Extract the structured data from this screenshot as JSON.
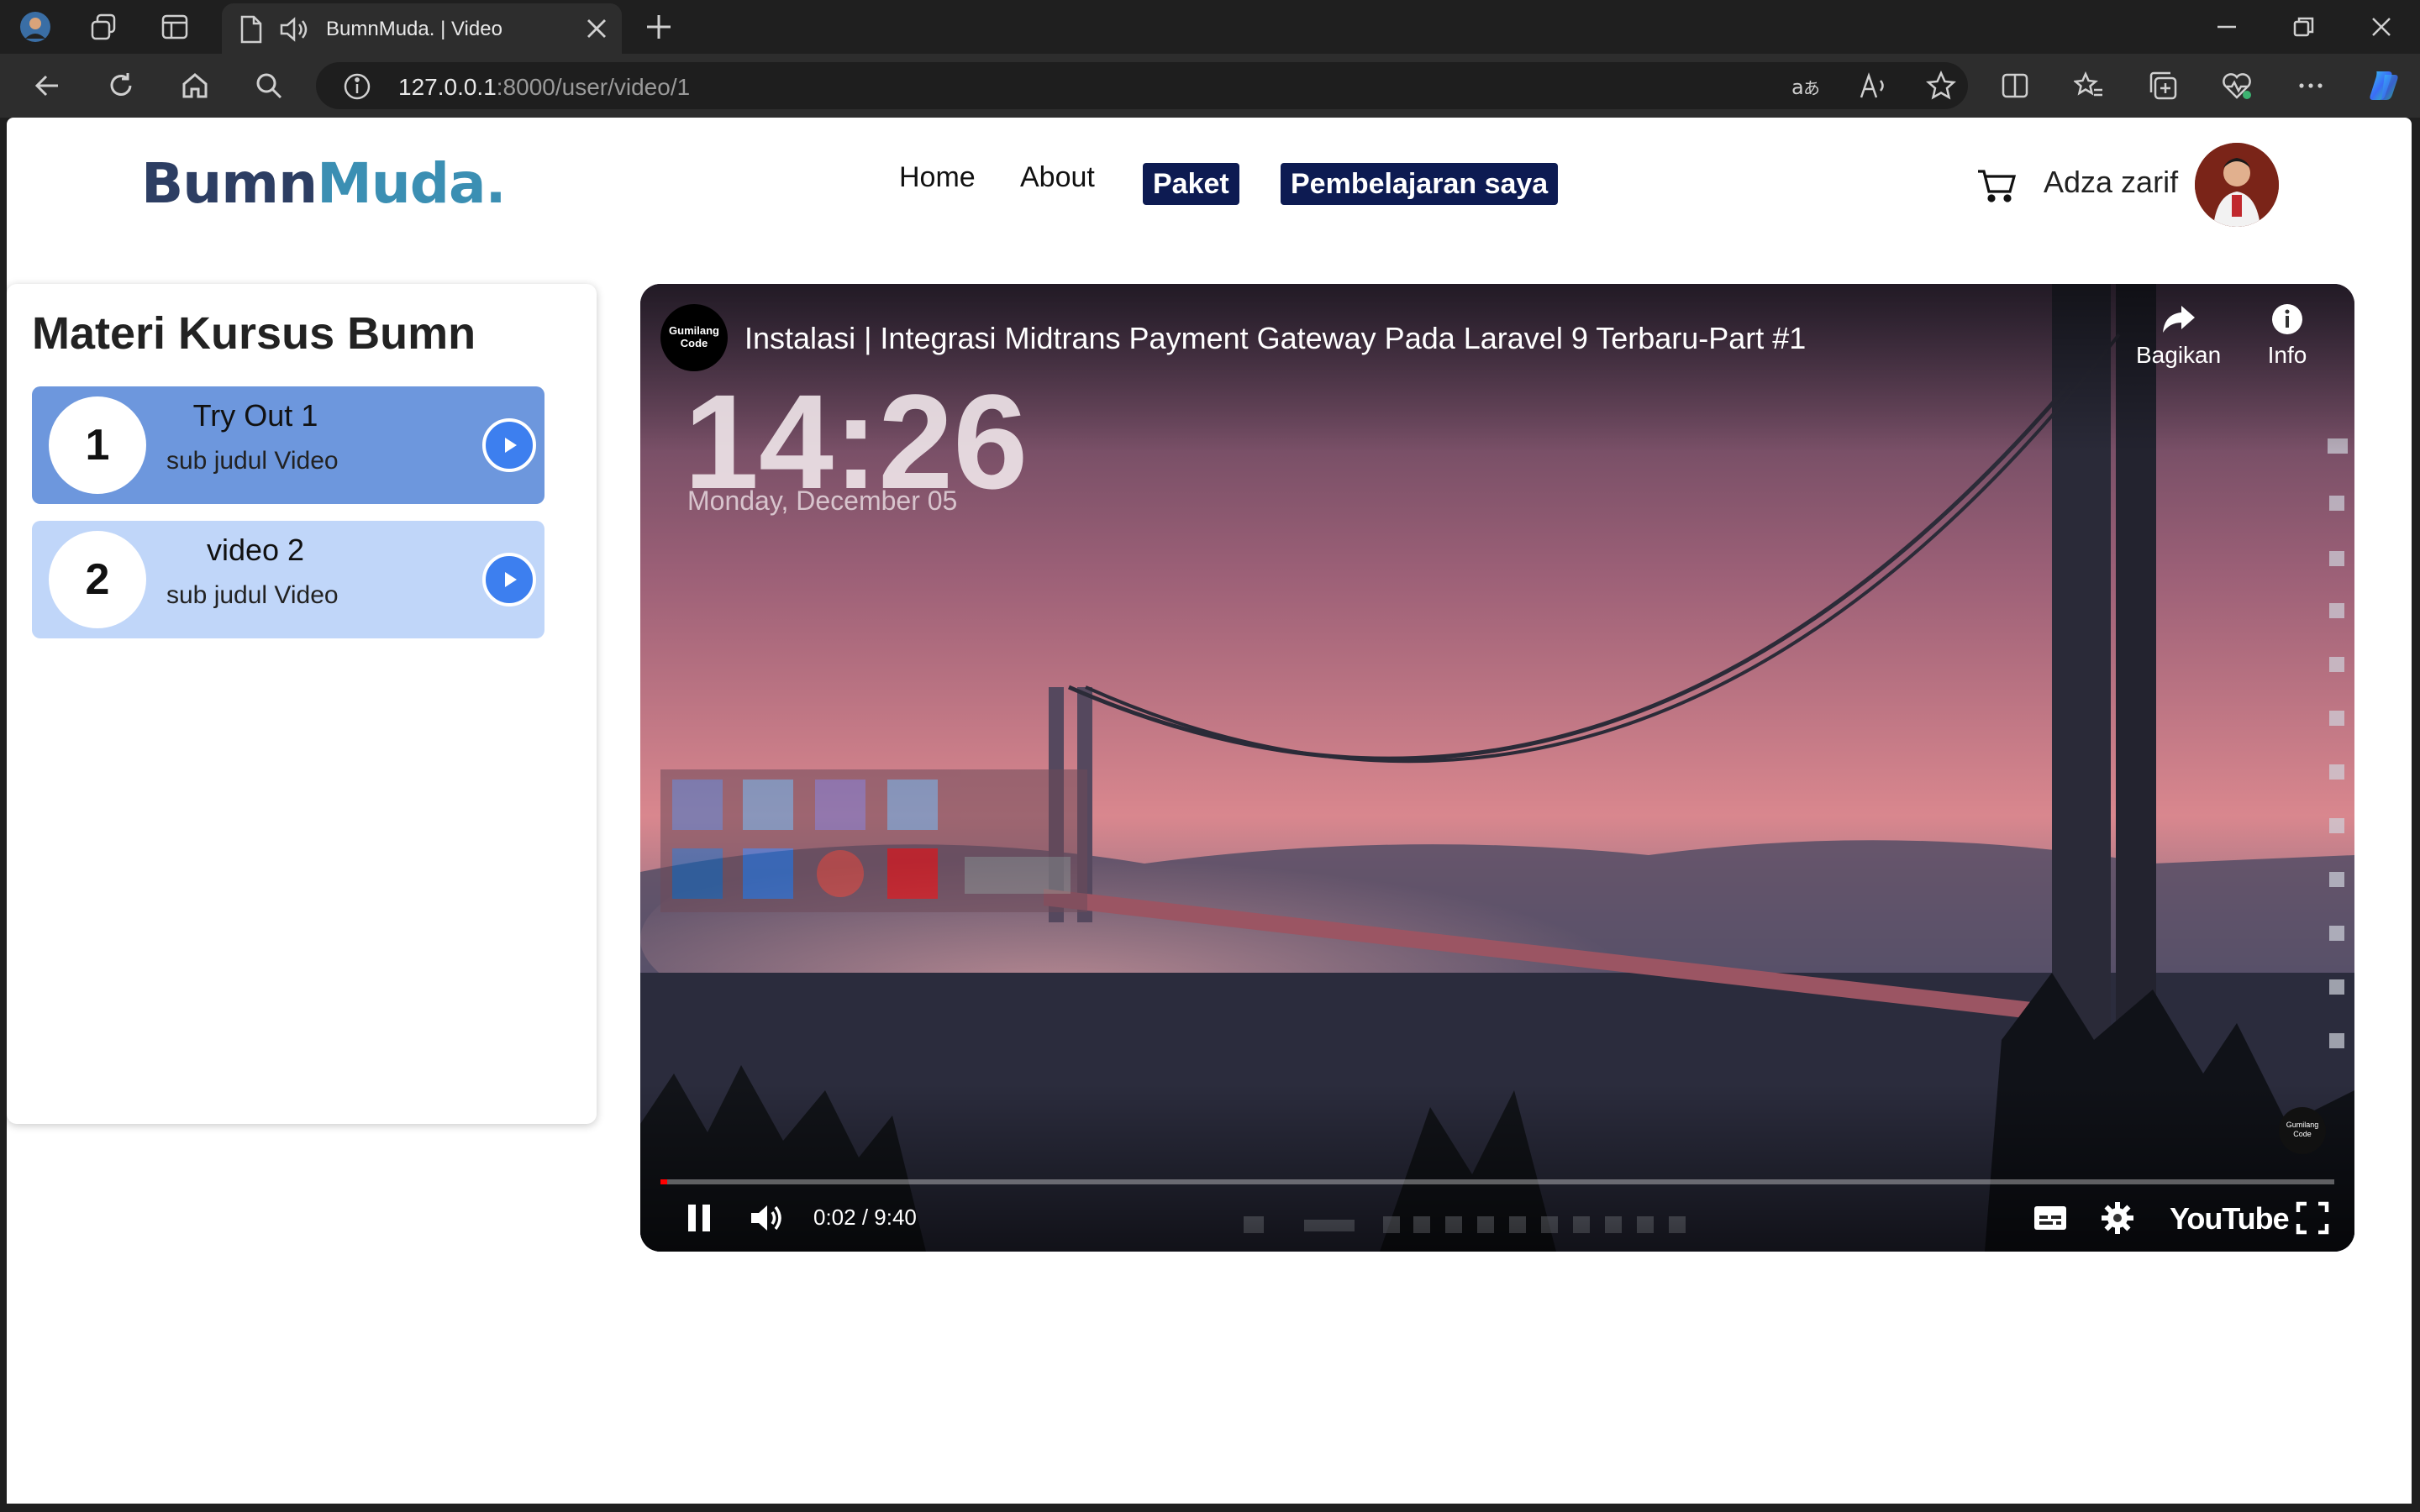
{
  "browser": {
    "tab_title": "BumnMuda. | Video",
    "url_host": "127.0.0.1",
    "url_path": ":8000/user/video/1"
  },
  "site": {
    "logo_part1": "Bumn",
    "logo_part2": "Muda.",
    "nav": {
      "home": "Home",
      "about": "About",
      "paket": "Paket",
      "pembelajaran": "Pembelajaran saya"
    },
    "user_name": "Adza zarif"
  },
  "sidebar": {
    "title": "Materi Kursus Bumn",
    "lessons": [
      {
        "number": "1",
        "title": "Try Out 1",
        "subtitle": "sub judul Video"
      },
      {
        "number": "2",
        "title": "video 2",
        "subtitle": "sub judul Video"
      }
    ]
  },
  "player": {
    "channel": "Gumilang Code",
    "title": "Instalasi | Integrasi Midtrans Payment Gateway Pada Laravel 9 Terbaru-Part #1",
    "share_label": "Bagikan",
    "info_label": "Info",
    "clock_text": "14:26",
    "date_text": "Monday, December 05",
    "time_display": "0:02 / 9:40",
    "progress": 0.0035,
    "brand": "YouTube"
  },
  "colors": {
    "logo_dark": "#2d3e63",
    "logo_light": "#3b8fb3",
    "nav_pill": "#0d1b52",
    "lesson_active": "#6d97dd",
    "lesson_inactive": "#c0d6f9",
    "play_button": "#3d7fef"
  }
}
